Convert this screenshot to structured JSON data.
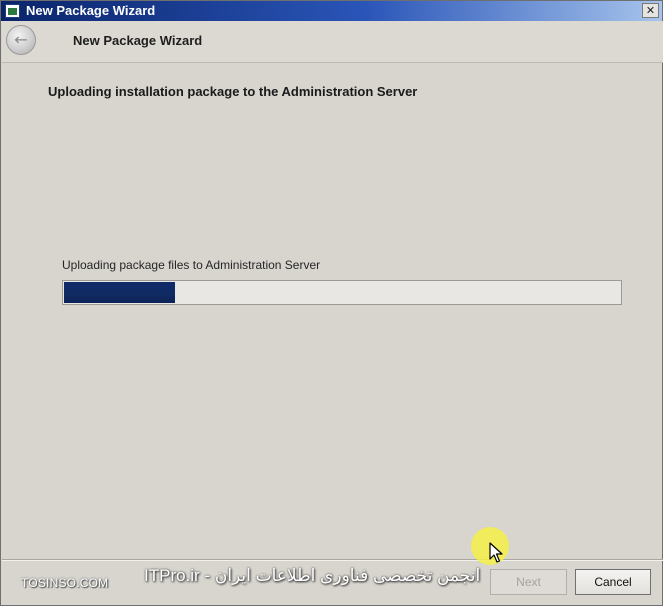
{
  "window": {
    "title": "New Package Wizard",
    "close_glyph": "✕"
  },
  "header": {
    "back_glyph": "←",
    "title": "New Package Wizard"
  },
  "content": {
    "heading": "Uploading installation package to the Administration Server",
    "status_text": "Uploading package files to Administration Server",
    "progress_fraction": 0.2
  },
  "footer": {
    "next_label": "Next",
    "cancel_label": "Cancel"
  },
  "watermarks": {
    "left": "TOSINSO.COM",
    "right": "ITPro.ir - انجمن تخصصی فناوری اطلاعات ایران"
  },
  "colors": {
    "titlebar_start": "#0a246a",
    "progress_fill": "#102a62",
    "highlight": "#f6f046"
  }
}
